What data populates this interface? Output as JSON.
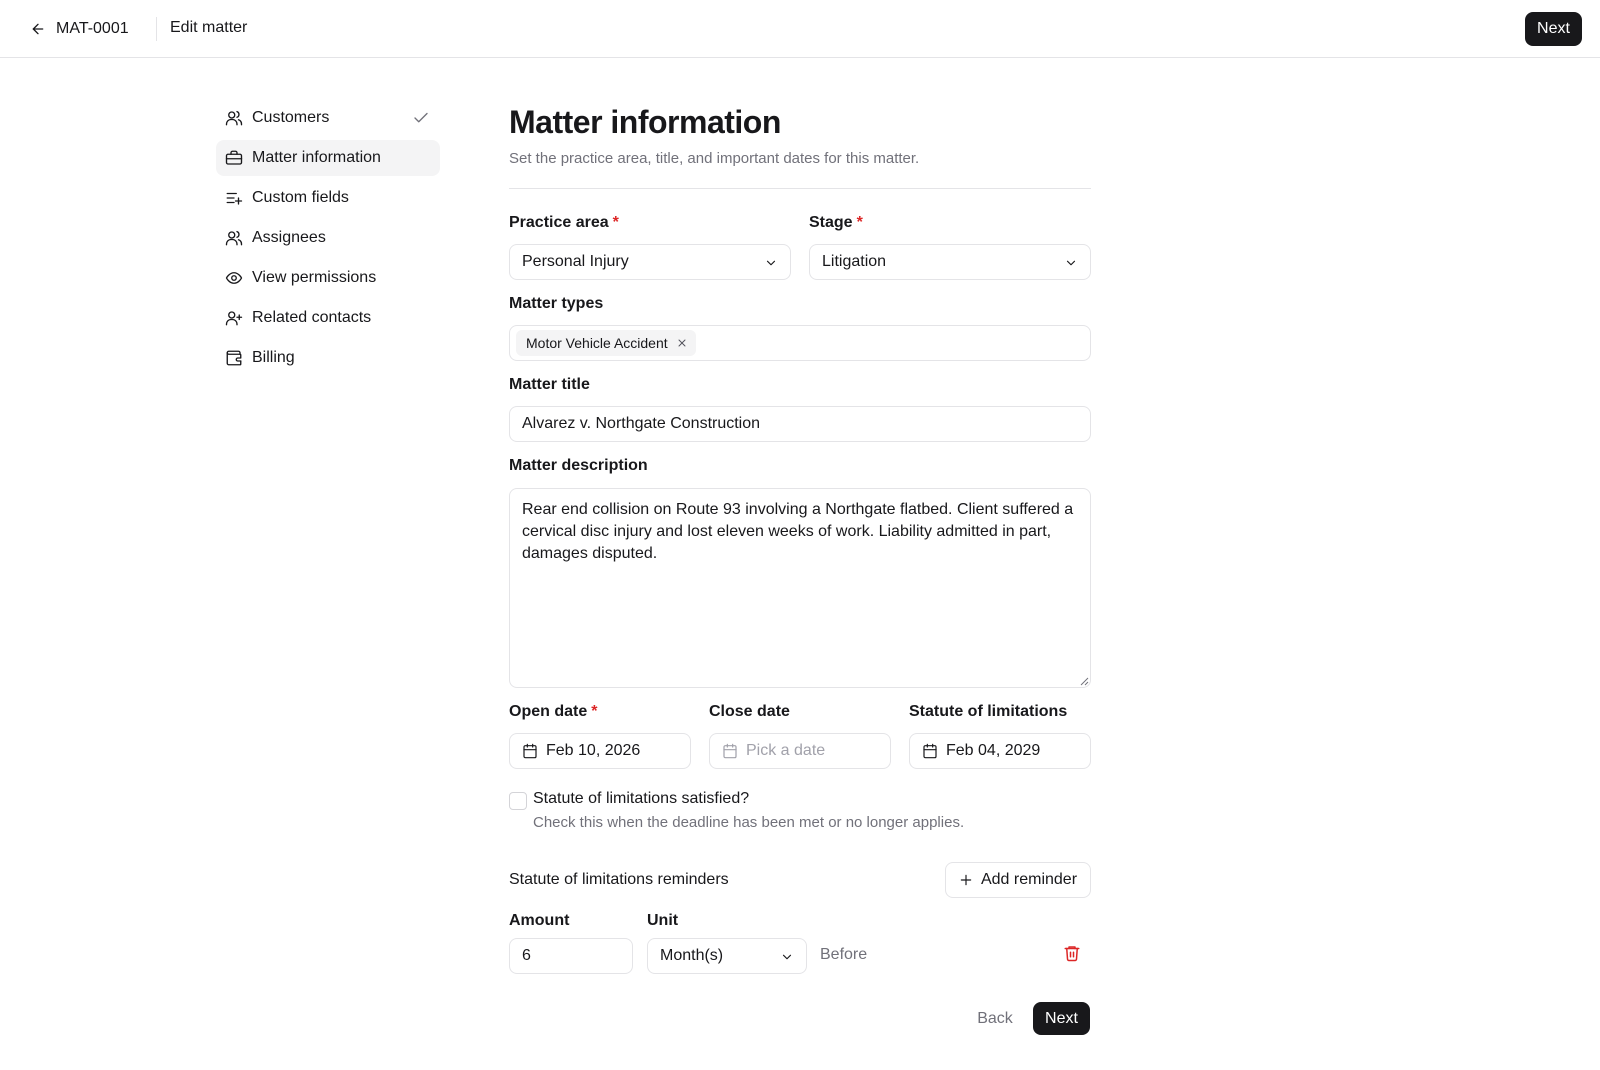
{
  "header": {
    "matter_id": "MAT-0001",
    "title": "Edit matter",
    "next_label": "Next"
  },
  "sidebar": {
    "items": [
      {
        "label": "Customers",
        "icon": "users-icon",
        "completed": true
      },
      {
        "label": "Matter information",
        "icon": "briefcase-icon",
        "active": true
      },
      {
        "label": "Custom fields",
        "icon": "list-plus-icon"
      },
      {
        "label": "Assignees",
        "icon": "users-icon"
      },
      {
        "label": "View permissions",
        "icon": "eye-icon"
      },
      {
        "label": "Related contacts",
        "icon": "user-plus-icon"
      },
      {
        "label": "Billing",
        "icon": "wallet-icon"
      }
    ]
  },
  "form": {
    "title": "Matter information",
    "subtitle": "Set the practice area, title, and important dates for this matter.",
    "practice_area": {
      "label": "Practice area",
      "required": "*",
      "value": "Personal Injury"
    },
    "stage": {
      "label": "Stage",
      "required": "*",
      "value": "Litigation"
    },
    "matter_types": {
      "label": "Matter types",
      "chips": [
        "Motor Vehicle Accident"
      ]
    },
    "matter_title": {
      "label": "Matter title",
      "value": "Alvarez v. Northgate Construction"
    },
    "matter_description": {
      "label": "Matter description",
      "value": "Rear end collision on Route 93 involving a Northgate flatbed. Client suffered a cervical disc injury and lost eleven weeks of work. Liability admitted in part, damages disputed."
    },
    "open_date": {
      "label": "Open date",
      "required": "*",
      "value": "Feb 10, 2026"
    },
    "close_date": {
      "label": "Close date",
      "placeholder": "Pick a date"
    },
    "statute_of_limitations": {
      "label": "Statute of limitations",
      "value": "Feb 04, 2029"
    },
    "sol_satisfied": {
      "label": "Statute of limitations satisfied?",
      "help": "Check this when the deadline has been met or no longer applies.",
      "checked": false
    },
    "reminders": {
      "title": "Statute of limitations reminders",
      "add_label": "Add reminder",
      "amount_label": "Amount",
      "unit_label": "Unit",
      "rows": [
        {
          "amount": "6",
          "unit": "Month(s)",
          "relation": "Before"
        }
      ]
    },
    "back_label": "Back",
    "next_label": "Next"
  },
  "colors": {
    "primary": "#18181b",
    "required": "#dc2626",
    "danger": "#dc2626",
    "muted": "#71717a",
    "border": "#e4e4e7",
    "active_bg": "#f4f4f5"
  }
}
